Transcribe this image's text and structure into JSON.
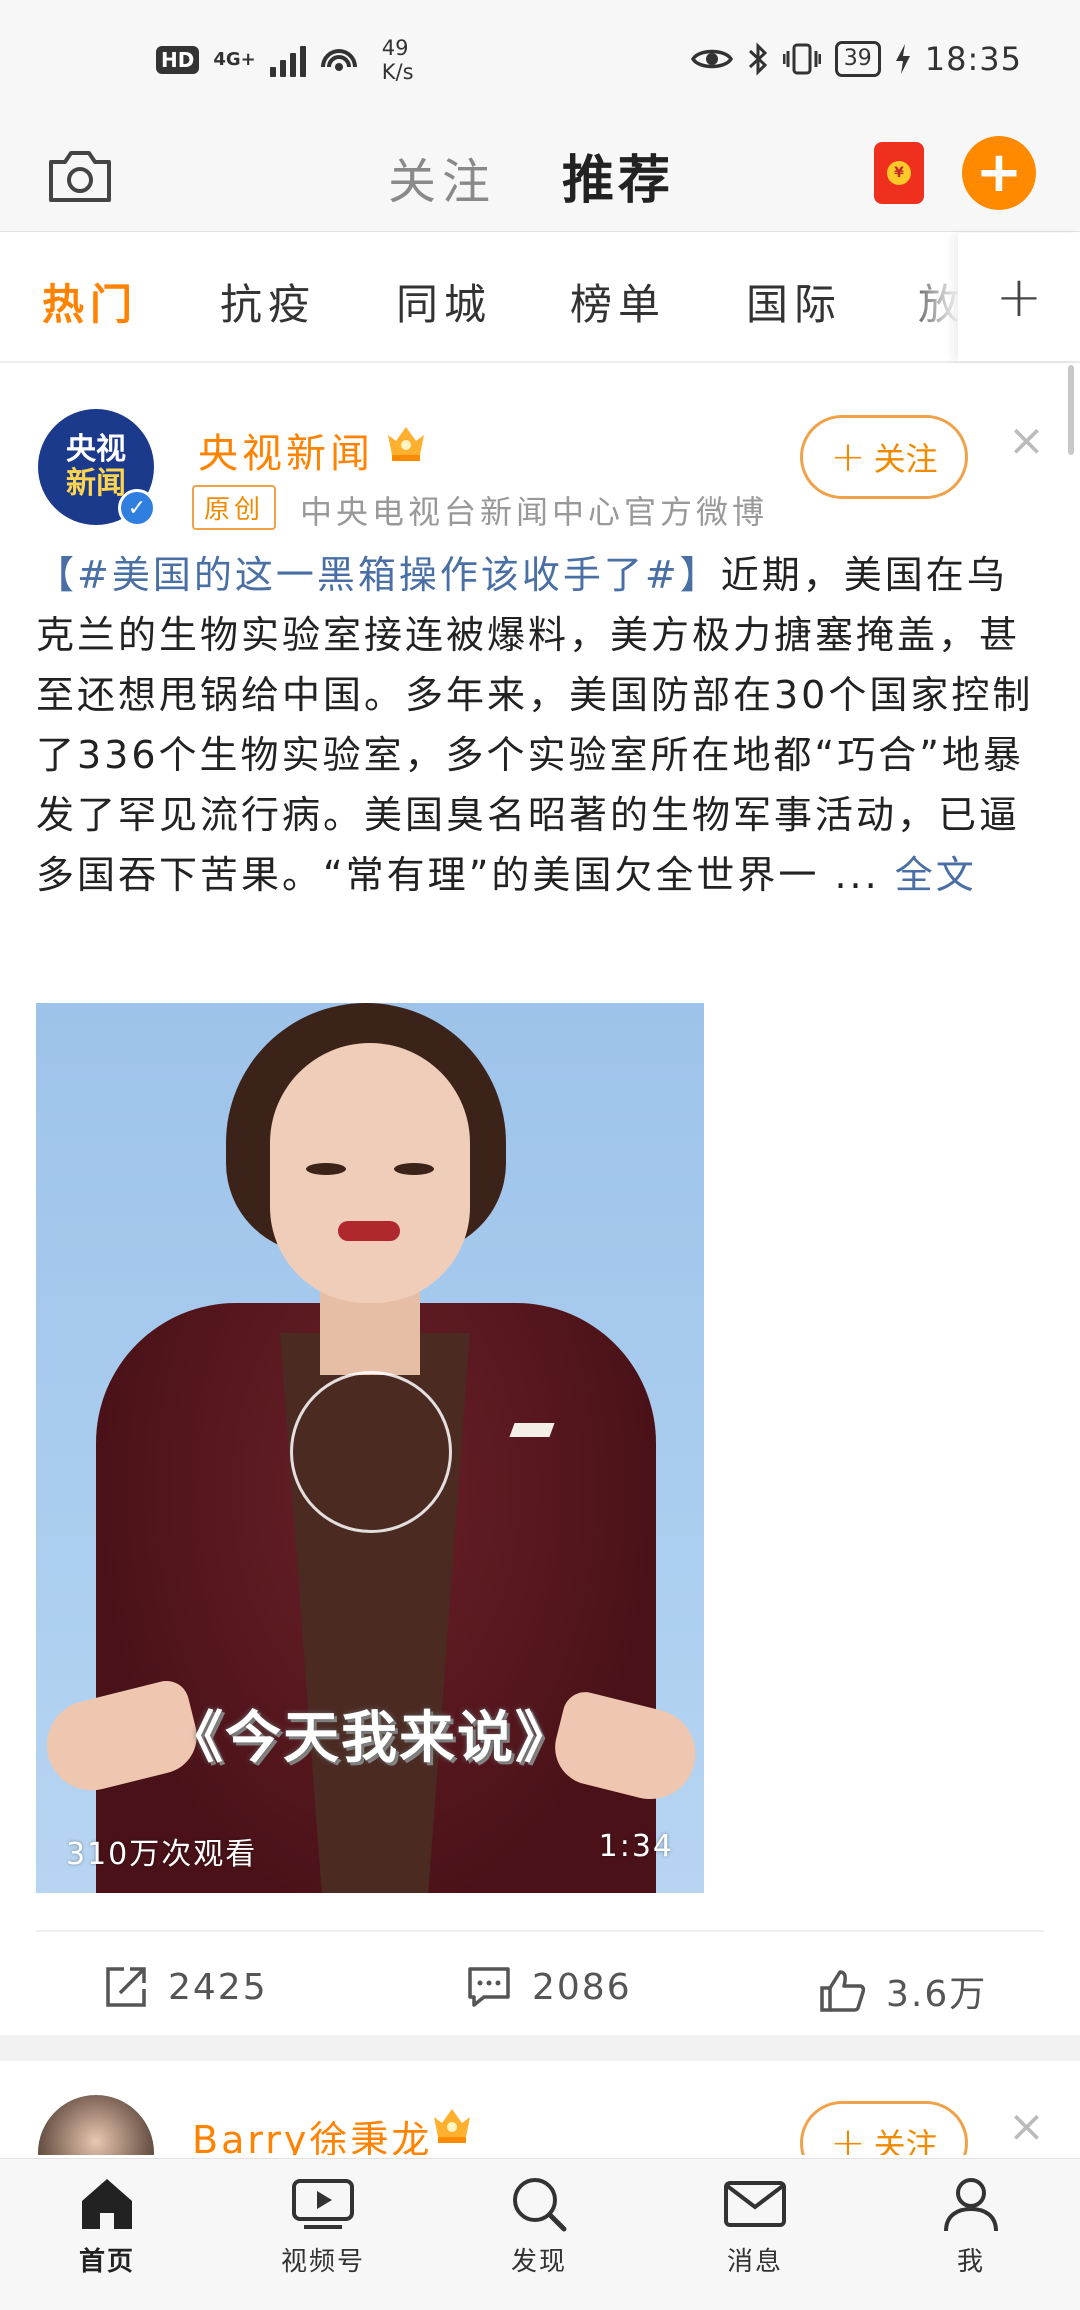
{
  "status_bar": {
    "hd": "HD",
    "network": "4G+",
    "speed_value": "49",
    "speed_unit": "K/s",
    "battery": "39",
    "time": "18:35"
  },
  "header": {
    "tab_follow": "关注",
    "tab_recommend": "推荐",
    "camera_icon": "camera-icon",
    "redpacket_icon": "red-packet-icon",
    "add_icon": "plus-icon"
  },
  "channels": [
    {
      "label": "热门",
      "active": true
    },
    {
      "label": "抗疫",
      "active": false
    },
    {
      "label": "同城",
      "active": false
    },
    {
      "label": "榜单",
      "active": false
    },
    {
      "label": "国际",
      "active": false
    },
    {
      "label": "放",
      "active": false
    }
  ],
  "channel_more": "+",
  "post": {
    "avatar_line1": "央视",
    "avatar_line2": "新闻",
    "author": "央视新闻",
    "original_tag": "原创",
    "author_desc": "中央电视台新闻中心官方微博",
    "follow_label": "关注",
    "topic": "【#美国的这一黑箱操作该收手了#】",
    "body": "近期，美国在乌克兰的生物实验室接连被爆料，美方极力搪塞掩盖，甚至还想甩锅给中国。多年来，美国防部在30个国家控制了336个生物实验室，多个实验室所在地都“巧合”地暴发了罕见流行病。美国臭名昭著的生物军事活动，已逼多国吞下苦果。“常有理”的美国欠全世界一 ...",
    "more_label": "全文",
    "video": {
      "caption": "《今天我来说》",
      "views": "310万次观看",
      "duration": "1:34"
    },
    "actions": {
      "repost": "2425",
      "comment": "2086",
      "like": "3.6万"
    }
  },
  "next_post": {
    "author": "Barry徐秉龙",
    "follow_label": "关注"
  },
  "bottom_nav": [
    {
      "label": "首页",
      "icon": "home-icon"
    },
    {
      "label": "视频号",
      "icon": "video-icon"
    },
    {
      "label": "发现",
      "icon": "search-icon"
    },
    {
      "label": "消息",
      "icon": "mail-icon"
    },
    {
      "label": "我",
      "icon": "profile-icon"
    }
  ],
  "colors": {
    "accent": "#ff8200",
    "link": "#4a6fa5",
    "verified": "#2f7ee0"
  }
}
